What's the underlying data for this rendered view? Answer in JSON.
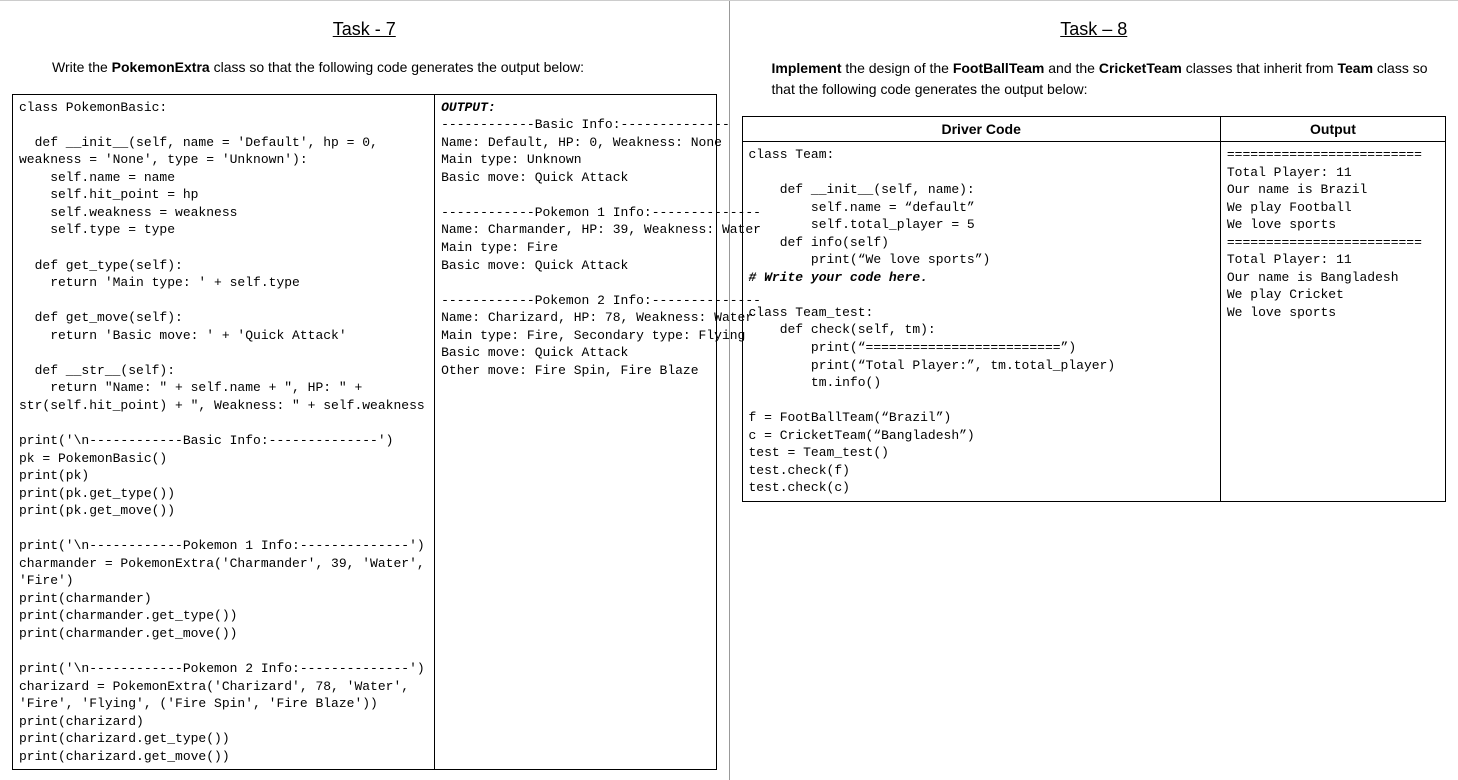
{
  "task7": {
    "title": "Task - 7",
    "instruction_pre": "Write the ",
    "instruction_bold": "PokemonExtra",
    "instruction_post": " class so that the following code generates the output below:",
    "code": "class PokemonBasic:\n\n  def __init__(self, name = 'Default', hp = 0,\nweakness = 'None', type = 'Unknown'):\n    self.name = name\n    self.hit_point = hp\n    self.weakness = weakness\n    self.type = type\n\n  def get_type(self):\n    return 'Main type: ' + self.type\n\n  def get_move(self):\n    return 'Basic move: ' + 'Quick Attack'\n\n  def __str__(self):\n    return \"Name: \" + self.name + \", HP: \" +\nstr(self.hit_point) + \", Weakness: \" + self.weakness\n\nprint('\\n------------Basic Info:--------------')\npk = PokemonBasic()\nprint(pk)\nprint(pk.get_type())\nprint(pk.get_move())\n\nprint('\\n------------Pokemon 1 Info:--------------')\ncharmander = PokemonExtra('Charmander', 39, 'Water',\n'Fire')\nprint(charmander)\nprint(charmander.get_type())\nprint(charmander.get_move())\n\nprint('\\n------------Pokemon 2 Info:--------------')\ncharizard = PokemonExtra('Charizard', 78, 'Water',\n'Fire', 'Flying', ('Fire Spin', 'Fire Blaze'))\nprint(charizard)\nprint(charizard.get_type())\nprint(charizard.get_move())",
    "output_label": "OUTPUT:",
    "output": "------------Basic Info:--------------\nName: Default, HP: 0, Weakness: None\nMain type: Unknown\nBasic move: Quick Attack\n\n------------Pokemon 1 Info:--------------\nName: Charmander, HP: 39, Weakness: Water\nMain type: Fire\nBasic move: Quick Attack\n\n------------Pokemon 2 Info:--------------\nName: Charizard, HP: 78, Weakness: Water\nMain type: Fire, Secondary type: Flying\nBasic move: Quick Attack\nOther move: Fire Spin, Fire Blaze"
  },
  "task8": {
    "title": "Task – 8",
    "instr_b1": "Implement",
    "instr_t1": " the design of the ",
    "instr_b2": "FootBallTeam",
    "instr_t2": " and the ",
    "instr_b3": "CricketTeam",
    "instr_t3": " classes that inherit from ",
    "instr_b4": "Team",
    "instr_t4": " class so that the following code generates the output below:",
    "header_left": "Driver Code",
    "header_right": "Output",
    "code_pre": "class Team:\n\n    def __init__(self, name):\n        self.name = “default”\n        self.total_player = 5\n    def info(self)\n        print(“We love sports”)\n",
    "code_comment": "# Write your code here.",
    "code_post": "\nclass Team_test:\n    def check(self, tm):\n        print(“=========================”)\n        print(“Total Player:”, tm.total_player)\n        tm.info()\n\nf = FootBallTeam(“Brazil”)\nc = CricketTeam(“Bangladesh”)\ntest = Team_test()\ntest.check(f)\ntest.check(c)",
    "output": "=========================\nTotal Player: 11\nOur name is Brazil\nWe play Football\nWe love sports\n=========================\nTotal Player: 11\nOur name is Bangladesh\nWe play Cricket\nWe love sports"
  }
}
